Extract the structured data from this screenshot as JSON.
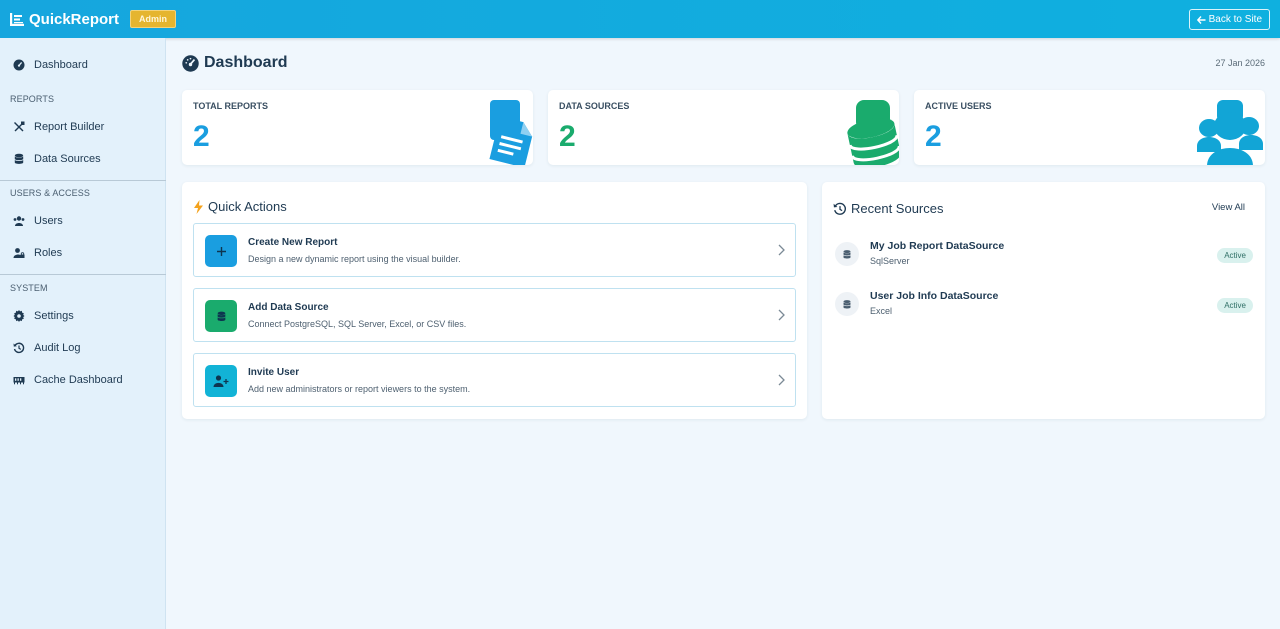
{
  "header": {
    "brand": "QuickReport",
    "role_badge": "Admin",
    "back_button": "Back to Site"
  },
  "sidebar": {
    "items": [
      {
        "label": "Dashboard",
        "icon": "tachometer-icon"
      },
      {
        "label": "Report Builder",
        "icon": "tools-icon"
      },
      {
        "label": "Data Sources",
        "icon": "database-icon"
      },
      {
        "label": "Users",
        "icon": "users-icon"
      },
      {
        "label": "Roles",
        "icon": "user-lock-icon"
      },
      {
        "label": "Settings",
        "icon": "gear-icon"
      },
      {
        "label": "Audit Log",
        "icon": "history-icon"
      },
      {
        "label": "Cache Dashboard",
        "icon": "memory-icon"
      }
    ],
    "sections": [
      "REPORTS",
      "USERS & ACCESS",
      "SYSTEM"
    ]
  },
  "page": {
    "title": "Dashboard",
    "date": "27 Jan 2026"
  },
  "stats": [
    {
      "label": "TOTAL REPORTS",
      "value": "2",
      "color": "#1a9ee0",
      "icon": "file-report-icon"
    },
    {
      "label": "DATA SOURCES",
      "value": "2",
      "color": "#1aab6d",
      "icon": "database-icon"
    },
    {
      "label": "ACTIVE USERS",
      "value": "2",
      "color": "#1a9ee0",
      "icon": "users-icon"
    }
  ],
  "quick_actions": {
    "title": "Quick Actions",
    "items": [
      {
        "title": "Create New Report",
        "desc": "Design a new dynamic report using the visual builder.",
        "color": "#1a9ee0",
        "icon": "plus-icon"
      },
      {
        "title": "Add Data Source",
        "desc": "Connect PostgreSQL, SQL Server, Excel, or CSV files.",
        "color": "#1aab6d",
        "icon": "database-icon"
      },
      {
        "title": "Invite User",
        "desc": "Add new administrators or report viewers to the system.",
        "color": "#12b3d6",
        "icon": "user-plus-icon"
      }
    ]
  },
  "recent_sources": {
    "title": "Recent Sources",
    "view_all": "View All",
    "items": [
      {
        "name": "My Job Report DataSource",
        "type": "SqlServer",
        "status": "Active"
      },
      {
        "name": "User Job Info DataSource",
        "type": "Excel",
        "status": "Active"
      }
    ]
  }
}
